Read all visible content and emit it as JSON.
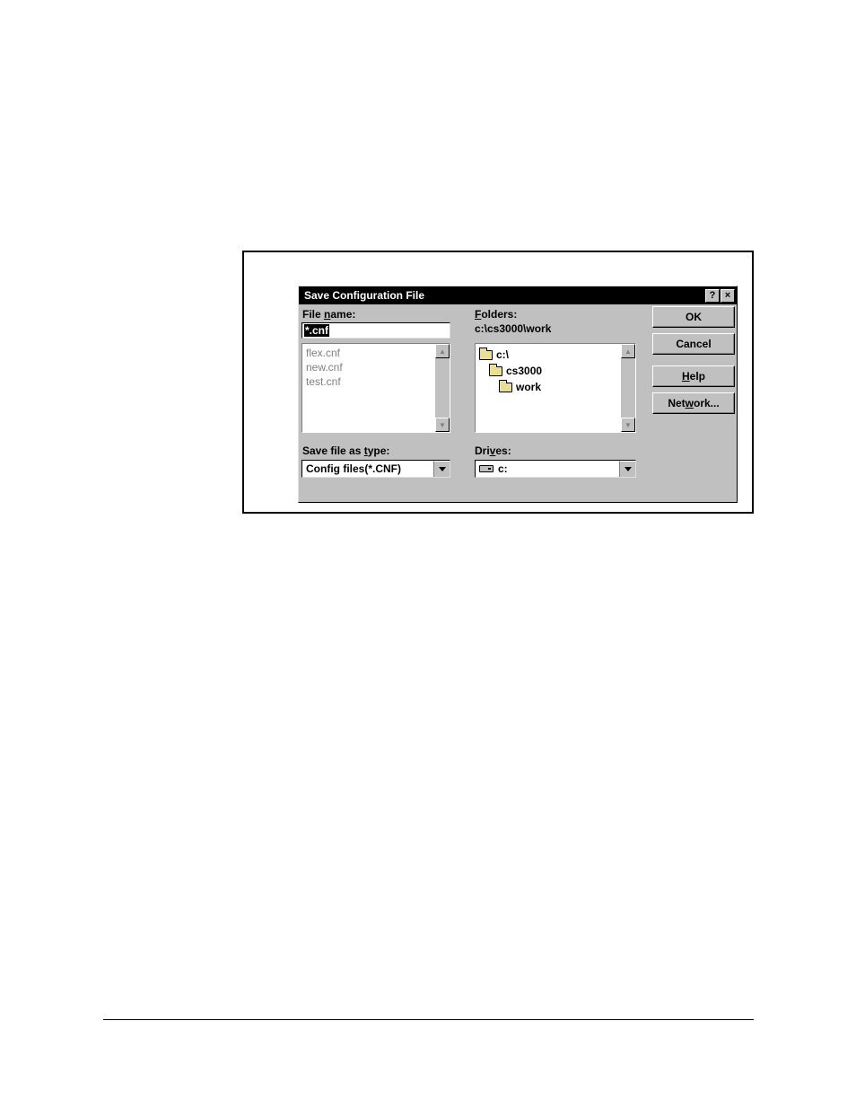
{
  "dialog": {
    "title": "Save Configuration File",
    "help_glyph": "?",
    "close_glyph": "×"
  },
  "labels": {
    "file_name_pre": "File ",
    "file_name_u": "n",
    "file_name_post": "ame:",
    "folders_u": "F",
    "folders_post": "olders:",
    "save_type_pre": "Save file as ",
    "save_type_u": "t",
    "save_type_post": "ype:",
    "drives_pre": "Dri",
    "drives_u": "v",
    "drives_post": "es:"
  },
  "file_name_value": "*.cnf",
  "file_list": [
    "flex.cnf",
    "new.cnf",
    "test.cnf"
  ],
  "current_path": "c:\\cs3000\\work",
  "folder_tree": {
    "root": "c:\\",
    "child1": "cs3000",
    "child2": "work"
  },
  "save_type_value": "Config files(*.CNF)",
  "drive_value": "c:",
  "buttons": {
    "ok": "OK",
    "cancel": "Cancel",
    "help_u": "H",
    "help_post": "elp",
    "network_pre": "Net",
    "network_u": "w",
    "network_post": "ork..."
  }
}
